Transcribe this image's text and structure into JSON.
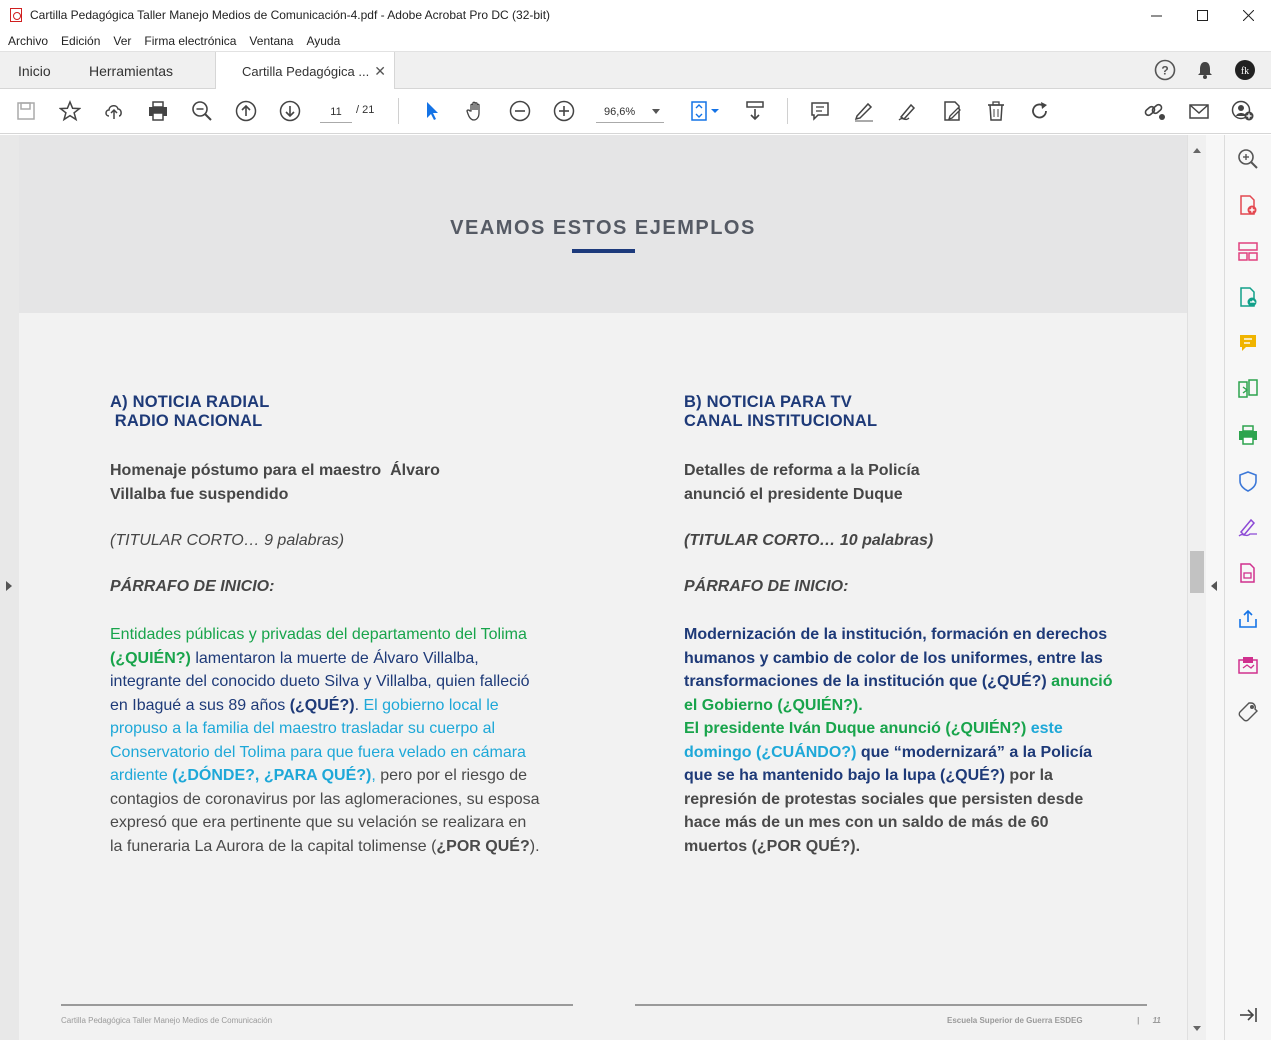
{
  "window": {
    "title": "Cartilla Pedagógica Taller Manejo Medios de Comunicación-4.pdf - Adobe Acrobat Pro DC (32-bit)"
  },
  "menu": [
    "Archivo",
    "Edición",
    "Ver",
    "Firma electrónica",
    "Ventana",
    "Ayuda"
  ],
  "tabs": {
    "home": "Inicio",
    "tools": "Herramientas",
    "doc": "Cartilla Pedagógica ..."
  },
  "toolbar": {
    "page_current": "11",
    "page_total": "/  21",
    "zoom": "96,6%"
  },
  "page": {
    "banner_title": "VEAMOS ESTOS EJEMPLOS",
    "col_a": {
      "title_line1": "A) NOTICIA RADIAL",
      "title_line2": " RADIO NACIONAL",
      "headline_line1": "Homenaje póstumo para el maestro  Álvaro",
      "headline_line2": "Villalba fue suspendido",
      "note": "(TITULAR CORTO… 9 palabras)",
      "parr_title": "PÁRRAFO DE INICIO:",
      "body": {
        "s1": "Entidades públicas y privadas del departamento del Tolima ",
        "s2": "(¿QUIÉN?)",
        "s3": " lamentaron la muerte de Álvaro Villalba, integrante del conocido dueto Silva y Villalba, quien falleció en Ibagué a sus 89 años ",
        "s4": "(¿QUÉ?)",
        "s5": ". ",
        "s6": "El gobierno local le propuso a la familia del maestro trasladar su cuerpo al Conservatorio del Tolima para que fuera velado en cámara ardiente ",
        "s7": "(¿DÓNDE?, ¿PARA QUÉ?)",
        "s8": ",",
        "s9": " pero por el riesgo de contagios de coronavirus por las aglomeraciones, su esposa expresó que era pertinente que su velación se realizara en la funeraria La Aurora de la capital tolimense (",
        "s10": "¿POR QUÉ?",
        "s11": ")."
      }
    },
    "col_b": {
      "title_line1": "B) NOTICIA PARA TV",
      "title_line2": "CANAL INSTITUCIONAL",
      "headline_line1": "Detalles de reforma a la Policía",
      "headline_line2": "anunció el presidente Duque",
      "note": "(TITULAR CORTO… 10 palabras)",
      "parr_title": "PÁRRAFO DE INICIO:",
      "body": {
        "s1": "Modernización de la institución, formación en derechos humanos y cambio de color de los uniformes, entre las transformaciones de la institución que ",
        "s2": "(¿QUÉ?)",
        "s3": " anunció el Gobierno ",
        "s4": "(¿QUIÉN?)",
        "s5": ".",
        "s6": "El presidente Iván Duque anunció ",
        "s7": "(¿QUIÉN?)",
        "s8": " este domingo ",
        "s9": "(¿CUÁNDO?)",
        "s10": " que “modernizará” a la Policía que se ha mantenido bajo la lupa ",
        "s11": "(¿QUÉ?)",
        "s12": " por la represión de protestas sociales que persisten desde hace más de un mes con un saldo de más de 60 muertos (",
        "s13": "¿POR QUÉ?",
        "s14": ")."
      }
    },
    "footer_left": "Cartilla Pedagógica Taller Manejo Medios de Comunicación",
    "footer_right": "Escuela  Superior de Guerra ESDEG",
    "footer_page": "|      11"
  },
  "colors": {
    "navy": "#1e3a78",
    "green": "#18a44b",
    "cyan": "#1ea8d8",
    "gray_text": "#4a4a4a",
    "acrobat_red": "#d01f1f"
  }
}
